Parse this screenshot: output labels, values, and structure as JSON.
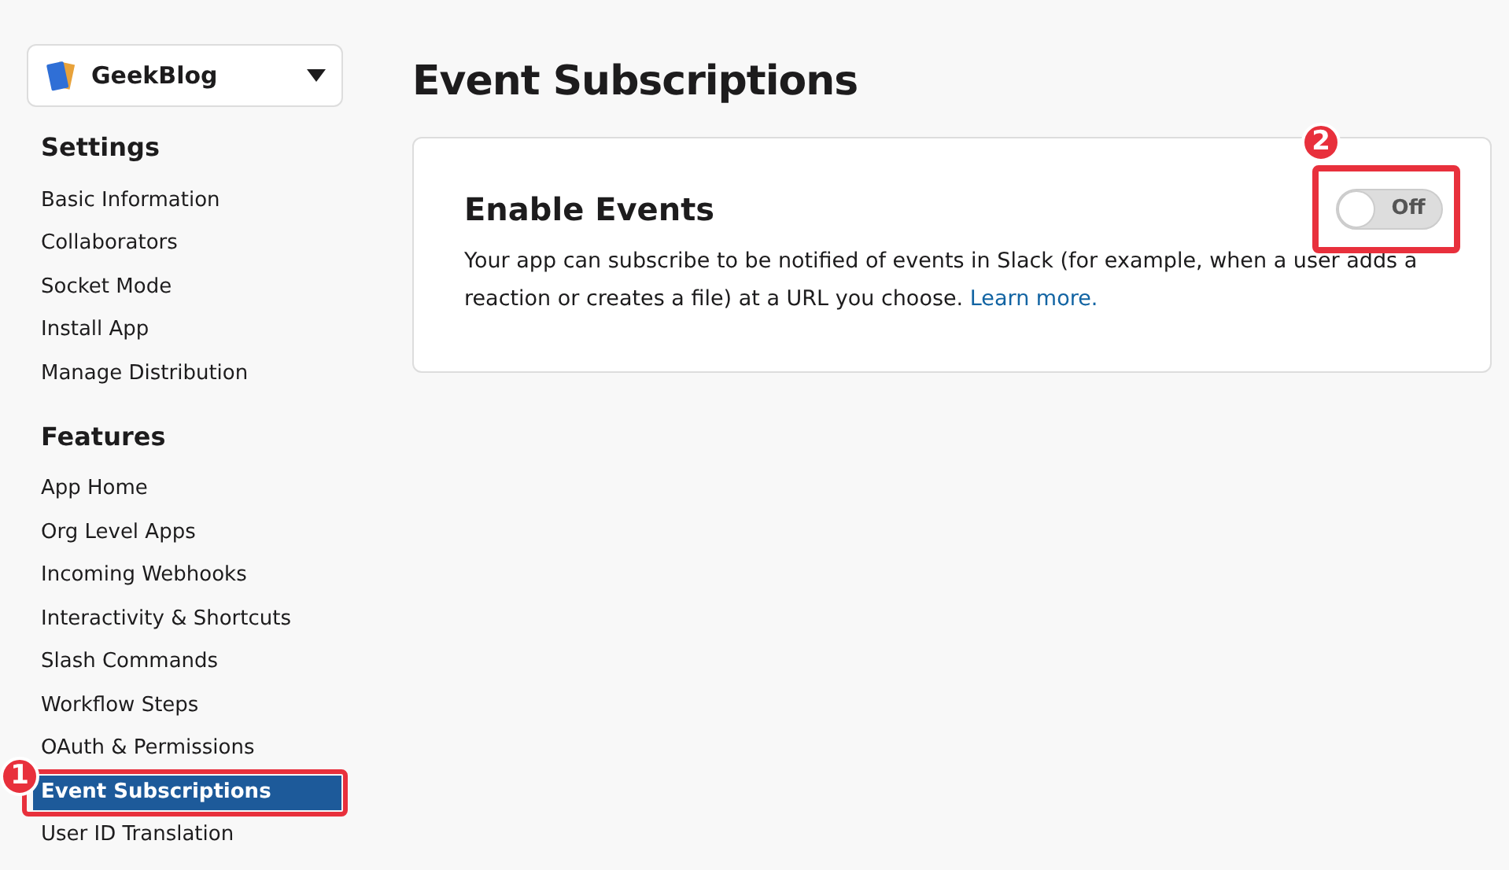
{
  "app_selector": {
    "name": "GeekBlog"
  },
  "sidebar": {
    "sections": [
      {
        "heading": "Settings",
        "items": [
          {
            "label": "Basic Information",
            "selected": false
          },
          {
            "label": "Collaborators",
            "selected": false
          },
          {
            "label": "Socket Mode",
            "selected": false
          },
          {
            "label": "Install App",
            "selected": false
          },
          {
            "label": "Manage Distribution",
            "selected": false
          }
        ]
      },
      {
        "heading": "Features",
        "items": [
          {
            "label": "App Home",
            "selected": false
          },
          {
            "label": "Org Level Apps",
            "selected": false
          },
          {
            "label": "Incoming Webhooks",
            "selected": false
          },
          {
            "label": "Interactivity & Shortcuts",
            "selected": false
          },
          {
            "label": "Slash Commands",
            "selected": false
          },
          {
            "label": "Workflow Steps",
            "selected": false
          },
          {
            "label": "OAuth & Permissions",
            "selected": false
          },
          {
            "label": "Event Subscriptions",
            "selected": true,
            "step": "1"
          },
          {
            "label": "User ID Translation",
            "selected": false
          }
        ]
      }
    ]
  },
  "page_title": "Event Subscriptions",
  "card": {
    "title": "Enable Events",
    "toggle": {
      "on": false,
      "label": "Off",
      "step": "2"
    },
    "description": "Your app can subscribe to be notified of events in Slack (for example, when a user adds a reaction or creates a file) at a URL you choose.",
    "link": "Learn more."
  }
}
